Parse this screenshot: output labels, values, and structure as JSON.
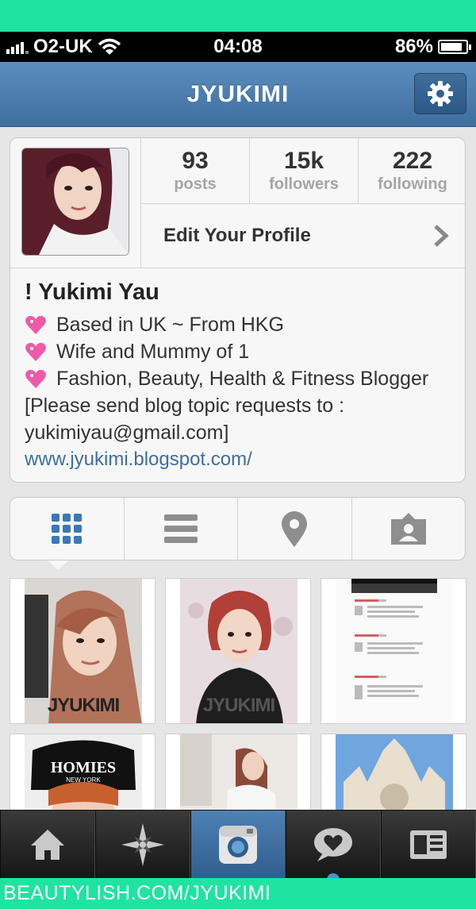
{
  "status_bar": {
    "carrier": "O2-UK",
    "time": "04:08",
    "battery_percent": "86%",
    "battery_level": 0.86
  },
  "nav": {
    "title": "JYUKIMI",
    "settings_icon": "gear-icon"
  },
  "profile": {
    "stats": [
      {
        "count": "93",
        "label": "posts"
      },
      {
        "count": "15k",
        "label": "followers"
      },
      {
        "count": "222",
        "label": "following"
      }
    ],
    "edit_label": "Edit Your Profile",
    "name": "! Yukimi Yau",
    "bio_lines": [
      "Based in UK ~ From HKG",
      "Wife and Mummy of 1",
      "Fashion, Beauty, Health & Fitness Blogger"
    ],
    "bio_note_1": "[Please send blog topic requests to :",
    "bio_note_2": "yukimiyau@gmail.com]",
    "website": "www.jyukimi.blogspot.com/"
  },
  "view_tabs": [
    "grid-view-icon",
    "list-view-icon",
    "map-pin-icon",
    "tagged-photos-icon"
  ],
  "photos": {
    "watermark": "JYUKIMI",
    "homies_text": "HOMIES",
    "homies_sub": "NEW YORK"
  },
  "tab_bar": [
    "home-icon",
    "explore-icon",
    "camera-icon",
    "news-icon",
    "profile-icon"
  ],
  "colors": {
    "accent": "#3f6fa0",
    "link": "#3e6f9e",
    "frame": "#1fe3a0"
  },
  "footer": "BEAUTYLISH.COM/JYUKIMI"
}
